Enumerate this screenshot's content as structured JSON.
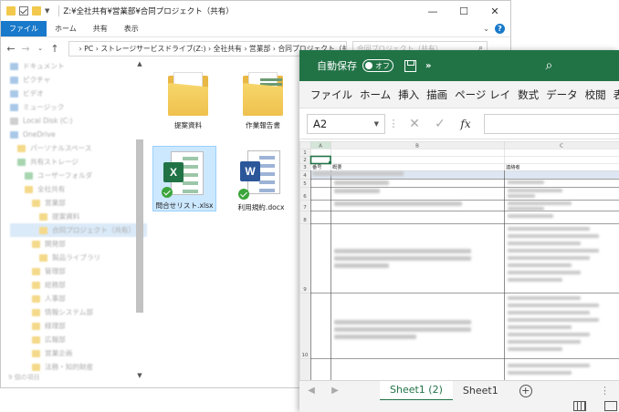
{
  "explorer": {
    "title_path": "Z:¥全社共有¥営業部¥合同プロジェクト（共有）",
    "window_buttons": {
      "minimize": "—",
      "maximize": "☐",
      "close": "✕"
    },
    "ribbon_tabs": [
      "ファイル",
      "ホーム",
      "共有",
      "表示"
    ],
    "address": {
      "segments": [
        "PC",
        "ストレージサービスドライブ(Z:)",
        "全社共有",
        "営業部",
        "合同プロジェクト（共有）"
      ]
    },
    "search_placeholder": "合同プロジェクト（共有）",
    "nav_items": [
      "ドキュメント",
      "ピクチャ",
      "ビデオ",
      "ミュージック",
      "Local Disk (C:)",
      "OneDrive",
      "パーソナルスペース",
      "共有ストレージ",
      "ユーザーフォルダ",
      "全社共有",
      "営業部",
      "提案資料",
      "合同プロジェクト（共有）",
      "開発部",
      "製品ライブラリ",
      "管理部",
      "総務部",
      "人事部",
      "情報システム部",
      "経理部",
      "広報部",
      "営業企画",
      "法務・知的財産"
    ],
    "item_count": "9 個の項目",
    "files": [
      {
        "name": "提案資料",
        "type": "folder"
      },
      {
        "name": "作業報告書",
        "type": "folder"
      },
      {
        "name": "問合せリスト.xlsx",
        "type": "excel",
        "badge": "X"
      },
      {
        "name": "利用規約.docx",
        "type": "word",
        "badge": "W"
      }
    ]
  },
  "excel": {
    "autosave_label": "自動保存",
    "autosave_state": "オフ",
    "qat_more": "»",
    "menu": [
      "ファイル",
      "ホーム",
      "挿入",
      "描画",
      "ページ レイ",
      "数式",
      "データ",
      "校閲",
      "表示"
    ],
    "name_box": "A2",
    "fx_label": "fx",
    "columns": [
      "A",
      "B",
      "C"
    ],
    "rows": [
      "1",
      "2",
      "3",
      "4",
      "5",
      "6",
      "7",
      "8",
      "9",
      "10"
    ],
    "header_row": [
      "番号",
      "概要",
      "連絡者"
    ],
    "sheet_tabs": [
      "Sheet1 (2)",
      "Sheet1"
    ],
    "add_sheet": "+",
    "kebab": "⋮"
  },
  "colors": {
    "excel_green": "#217346",
    "explorer_blue": "#1979ca",
    "folder_yellow": "#efc14e",
    "selection_blue": "#cce8ff",
    "word_blue": "#2b579a",
    "sync_green": "#3ba53b"
  }
}
